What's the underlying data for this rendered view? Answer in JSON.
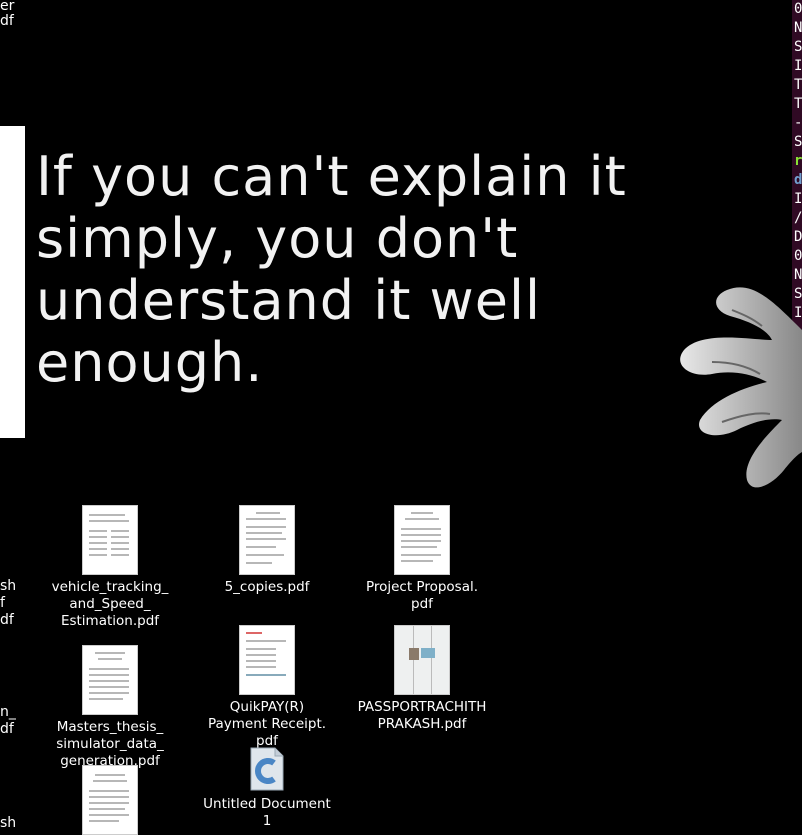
{
  "edge_labels": {
    "top_1": "er",
    "top_2": "df",
    "mid_1": "sh",
    "mid_2": "f",
    "mid_3": "df",
    "low_1": "n_",
    "low_2": "df",
    "bot_1": "sh"
  },
  "wallpaper": {
    "quote": "If you can't explain it simply, you don't understand it well enough."
  },
  "terminal": {
    "lines": [
      "0",
      "N",
      "S",
      "I",
      "T",
      "T",
      "-",
      "S",
      "r",
      "d",
      "I",
      "/",
      "D",
      "0",
      "N",
      "S",
      "I"
    ]
  },
  "desktop_icons": [
    {
      "label": "vehicle_tracking_\nand_Speed_\nEstimation.pdf",
      "type": "pdf"
    },
    {
      "label": "5_copies.pdf",
      "type": "pdf"
    },
    {
      "label": "Project Proposal.\npdf",
      "type": "pdf"
    },
    {
      "label": "Masters_thesis_\nsimulator_data_\ngeneration.pdf",
      "type": "pdf"
    },
    {
      "label": "QuikPAY(R)\nPayment Receipt.\npdf",
      "type": "pdf"
    },
    {
      "label": "PASSPORTRACHITH\nPRAKASH.pdf",
      "type": "pdf"
    },
    {
      "label": "Untitled Document\n1",
      "type": "text"
    },
    {
      "label": "",
      "type": "pdf"
    }
  ],
  "colors": {
    "desktop_bg": "#000000",
    "terminal_bg": "#300a24",
    "terminal_green": "#8ae234",
    "terminal_blue": "#729fcf"
  }
}
